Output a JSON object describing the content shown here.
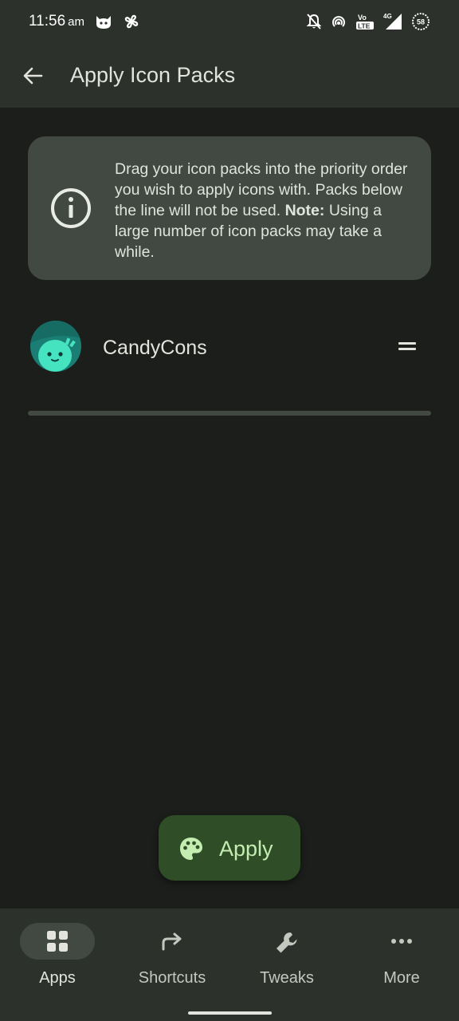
{
  "status_bar": {
    "time": "11:56",
    "ampm": "am",
    "network": "4G",
    "volte": "Vo LTE",
    "battery": "58"
  },
  "app_bar": {
    "title": "Apply Icon Packs"
  },
  "info_card": {
    "line_main": "Drag your icon packs into the priority order you wish to apply icons with. Packs below the line will not be used.",
    "note_label": "Note:",
    "note_text": "Using a large number of icon packs may take a while."
  },
  "packs": [
    {
      "name": "CandyCons"
    }
  ],
  "fab": {
    "label": "Apply"
  },
  "bottom_nav": {
    "items": [
      {
        "label": "Apps",
        "icon": "grid-icon",
        "active": true
      },
      {
        "label": "Shortcuts",
        "icon": "forward-arrow-icon",
        "active": false
      },
      {
        "label": "Tweaks",
        "icon": "wrench-icon",
        "active": false
      },
      {
        "label": "More",
        "icon": "more-horiz-icon",
        "active": false
      }
    ]
  },
  "colors": {
    "background": "#1b1e1b",
    "surface": "#2c312c",
    "card": "#424942",
    "fab": "#2f4d26",
    "fab_text": "#c4eeb1",
    "avatar_bg": "#1a7e74",
    "avatar_face": "#45e3c0"
  }
}
